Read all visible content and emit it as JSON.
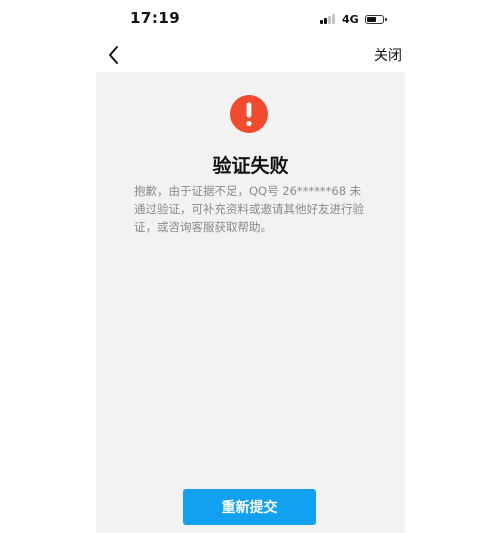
{
  "status_bar": {
    "time": "17:19",
    "network": "4G",
    "battery_level": 0.6,
    "signal_bars_active": 2,
    "signal_bars_total": 4
  },
  "nav": {
    "back_icon": "chevron-left-icon",
    "close_label": "关闭"
  },
  "main": {
    "alert_icon": "exclamation-circle-icon",
    "title": "验证失败",
    "message": "抱歉，由于证据不足，QQ号 26******68 未通过验证，可补充资料或邀请其他好友进行验证，或咨询客服获取帮助。",
    "button_label": "重新提交"
  },
  "colors": {
    "alert_red": "#f04a2f",
    "button_blue": "#12a0f0",
    "card_bg": "#f2f2f2",
    "message_gray": "#8a8a8a"
  }
}
